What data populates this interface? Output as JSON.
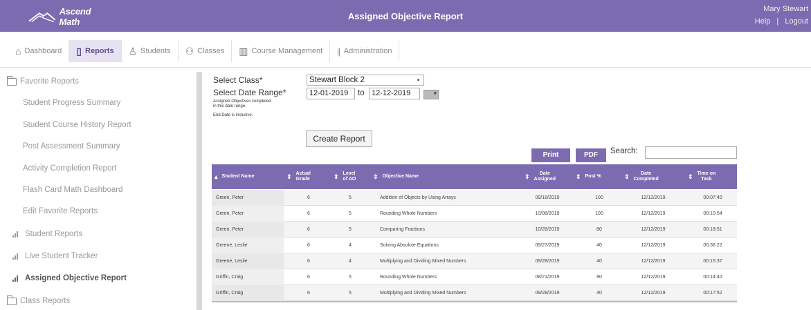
{
  "header": {
    "logo_text": "Ascend Math",
    "title": "Assigned Objective Report",
    "user_name": "Mary Stewart",
    "help_label": "Help",
    "separator": "|",
    "logout_label": "Logout"
  },
  "nav": {
    "items": [
      {
        "label": "Dashboard",
        "icon": "home-icon"
      },
      {
        "label": "Reports",
        "icon": "reports-icon"
      },
      {
        "label": "Students",
        "icon": "user-icon"
      },
      {
        "label": "Classes",
        "icon": "users-icon"
      },
      {
        "label": "Course Management",
        "icon": "course-icon"
      },
      {
        "label": "Administration",
        "icon": "admin-icon"
      }
    ]
  },
  "sidebar": {
    "items": [
      {
        "label": "Favorite Reports",
        "icon": "folder-icon"
      },
      {
        "label": "Student Progress Summary"
      },
      {
        "label": "Student Course History Report"
      },
      {
        "label": "Post Assessment Summary"
      },
      {
        "label": "Activity Completion Report"
      },
      {
        "label": "Flash Card Math Dashboard"
      },
      {
        "label": "Edit Favorite Reports"
      },
      {
        "label": "Student Reports",
        "icon": "bar-chart-icon"
      },
      {
        "label": "Live Student Tracker",
        "icon": "bar-chart-icon"
      },
      {
        "label": "Assigned Objective Report",
        "icon": "bar-chart-icon"
      },
      {
        "label": "Class Reports",
        "icon": "folder-icon"
      }
    ]
  },
  "form": {
    "select_class_label": "Select Class*",
    "select_class_value": "Stewart Block 2",
    "date_range_label": "Select Date Range*",
    "note_line1": "Assigned Objectives completed",
    "note_line2": "in this date range.",
    "note_line3": "End Date is inclusive.",
    "start_date": "12-01-2019",
    "to_label": "to",
    "end_date": "12-12-2019",
    "create_button": "Create Report",
    "print_button": "Print",
    "pdf_button": "PDF",
    "search_label": "Search:"
  },
  "table": {
    "headers": {
      "student": "Student Name",
      "grade_l1": "Actual",
      "grade_l2": "Grade",
      "level_l1": "Level",
      "level_l2": "of AO",
      "objective": "Objective Name",
      "assigned_l1": "Date",
      "assigned_l2": "Assigned",
      "posttest": "Post %",
      "completed_l1": "Date",
      "completed_l2": "Completed",
      "time_l1": "Time on",
      "time_l2": "Task"
    },
    "rows": [
      {
        "student": "Green, Peter",
        "grade": "6",
        "level": "5",
        "objective": "Addition of Objects by Using Arrays",
        "assigned": "09/18/2019",
        "post": "100",
        "completed": "12/12/2019",
        "time": "00:07:40"
      },
      {
        "student": "Green, Peter",
        "grade": "6",
        "level": "5",
        "objective": "Rounding Whole Numbers",
        "assigned": "10/08/2019",
        "post": "100",
        "completed": "12/12/2019",
        "time": "00:10:54"
      },
      {
        "student": "Green, Peter",
        "grade": "6",
        "level": "5",
        "objective": "Comparing Fractions",
        "assigned": "10/28/2019",
        "post": "80",
        "completed": "12/12/2019",
        "time": "00:18:51"
      },
      {
        "student": "Greene, Leslie",
        "grade": "6",
        "level": "4",
        "objective": "Solving Absolute Equations",
        "assigned": "09/27/2019",
        "post": "40",
        "completed": "12/12/2019",
        "time": "00:36:22"
      },
      {
        "student": "Greene, Leslie",
        "grade": "6",
        "level": "4",
        "objective": "Multiplying and Dividing Mixed Numbers",
        "assigned": "09/28/2019",
        "post": "40",
        "completed": "12/12/2019",
        "time": "00:15:37"
      },
      {
        "student": "Griffin, Craig",
        "grade": "6",
        "level": "5",
        "objective": "Rounding Whole Numbers",
        "assigned": "08/21/2019",
        "post": "80",
        "completed": "12/12/2019",
        "time": "00:14:40"
      },
      {
        "student": "Griffin, Craig",
        "grade": "6",
        "level": "5",
        "objective": "Multiplying and Dividing Mixed Numbers",
        "assigned": "09/28/2019",
        "post": "40",
        "completed": "12/12/2019",
        "time": "00:17:52"
      }
    ]
  },
  "colors": {
    "brand": "#7d6bb1",
    "active_tab_bg": "#e7e2f2"
  }
}
